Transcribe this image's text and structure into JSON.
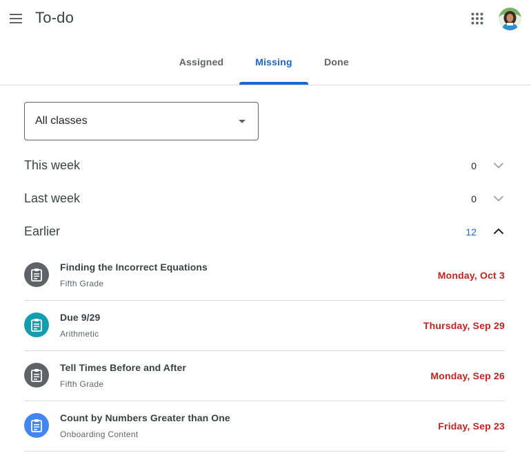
{
  "app": {
    "title": "To-do"
  },
  "header": {
    "menu_icon": "hamburger-menu-icon",
    "apps_icon": "apps-grid-icon",
    "avatar_icon": "user-avatar"
  },
  "tabs": [
    {
      "label": "Assigned",
      "active": false
    },
    {
      "label": "Missing",
      "active": true
    },
    {
      "label": "Done",
      "active": false
    }
  ],
  "filter": {
    "selected": "All classes"
  },
  "sections": [
    {
      "title": "This week",
      "count": "0",
      "expanded": false
    },
    {
      "title": "Last week",
      "count": "0",
      "expanded": false
    },
    {
      "title": "Earlier",
      "count": "12",
      "expanded": true
    }
  ],
  "tasks": [
    {
      "title": "Finding the Incorrect Equations",
      "class": "Fifth Grade",
      "due": "Monday, Oct 3",
      "icon_color": "#5f6368"
    },
    {
      "title": "Due 9/29",
      "class": "Arithmetic",
      "due": "Thursday, Sep 29",
      "icon_color": "#129eaf"
    },
    {
      "title": "Tell Times Before and After",
      "class": "Fifth Grade",
      "due": "Monday, Sep 26",
      "icon_color": "#5f6368"
    },
    {
      "title": "Count by Numbers Greater than One",
      "class": "Onboarding Content",
      "due": "Friday, Sep 23",
      "icon_color": "#4285f4"
    }
  ],
  "colors": {
    "accent": "#1967d2",
    "overdue": "#c5221f",
    "divider": "#dadce0"
  }
}
